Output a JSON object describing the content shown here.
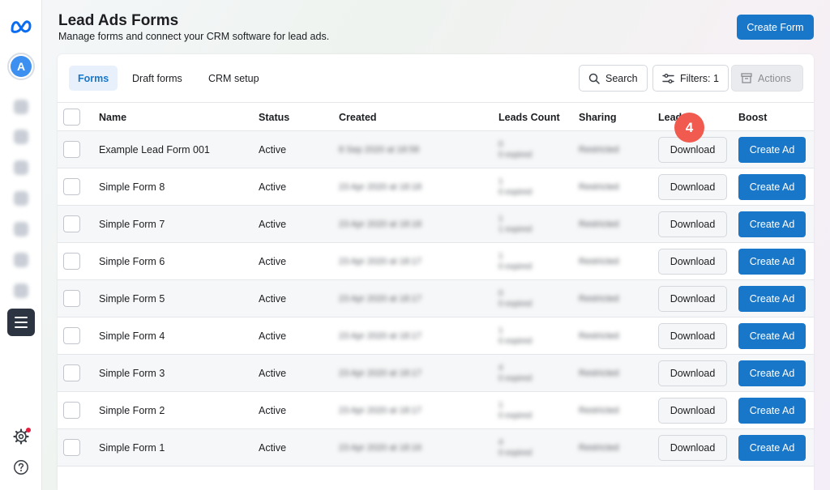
{
  "app": {
    "brand_icon": "meta-logo-icon",
    "avatar_initial": "A",
    "accent": "#1877c9"
  },
  "header": {
    "title": "Lead Ads Forms",
    "subtitle": "Manage forms and connect your CRM software for lead ads.",
    "create_form_label": "Create Form"
  },
  "tabs": [
    {
      "label": "Forms",
      "active": true
    },
    {
      "label": "Draft forms",
      "active": false
    },
    {
      "label": "CRM setup",
      "active": false
    }
  ],
  "toolbar": {
    "search_label": "Search",
    "filters_label": "Filters: 1",
    "actions_label": "Actions"
  },
  "table": {
    "columns": [
      "Name",
      "Status",
      "Created",
      "Leads Count",
      "Sharing",
      "Lead",
      "Boost"
    ],
    "download_label": "Download",
    "create_ad_label": "Create Ad",
    "rows": [
      {
        "name": "Example Lead Form 001",
        "status": "Active",
        "created": "8 Sep 2020 at 18:58",
        "leads_count": "0",
        "leads_sub": "0 expired",
        "sharing": "Restricted"
      },
      {
        "name": "Simple Form 8",
        "status": "Active",
        "created": "23 Apr 2020 at 18:18",
        "leads_count": "1",
        "leads_sub": "0 expired",
        "sharing": "Restricted"
      },
      {
        "name": "Simple Form 7",
        "status": "Active",
        "created": "23 Apr 2020 at 18:18",
        "leads_count": "1",
        "leads_sub": "1 expired",
        "sharing": "Restricted"
      },
      {
        "name": "Simple Form 6",
        "status": "Active",
        "created": "23 Apr 2020 at 18:17",
        "leads_count": "1",
        "leads_sub": "0 expired",
        "sharing": "Restricted"
      },
      {
        "name": "Simple Form 5",
        "status": "Active",
        "created": "23 Apr 2020 at 18:17",
        "leads_count": "0",
        "leads_sub": "0 expired",
        "sharing": "Restricted"
      },
      {
        "name": "Simple Form 4",
        "status": "Active",
        "created": "23 Apr 2020 at 18:17",
        "leads_count": "1",
        "leads_sub": "0 expired",
        "sharing": "Restricted"
      },
      {
        "name": "Simple Form 3",
        "status": "Active",
        "created": "23 Apr 2020 at 18:17",
        "leads_count": "4",
        "leads_sub": "0 expired",
        "sharing": "Restricted"
      },
      {
        "name": "Simple Form 2",
        "status": "Active",
        "created": "23 Apr 2020 at 18:17",
        "leads_count": "1",
        "leads_sub": "0 expired",
        "sharing": "Restricted"
      },
      {
        "name": "Simple Form 1",
        "status": "Active",
        "created": "23 Apr 2020 at 18:16",
        "leads_count": "4",
        "leads_sub": "0 expired",
        "sharing": "Restricted"
      }
    ]
  },
  "annotation": {
    "step_number": "4"
  }
}
